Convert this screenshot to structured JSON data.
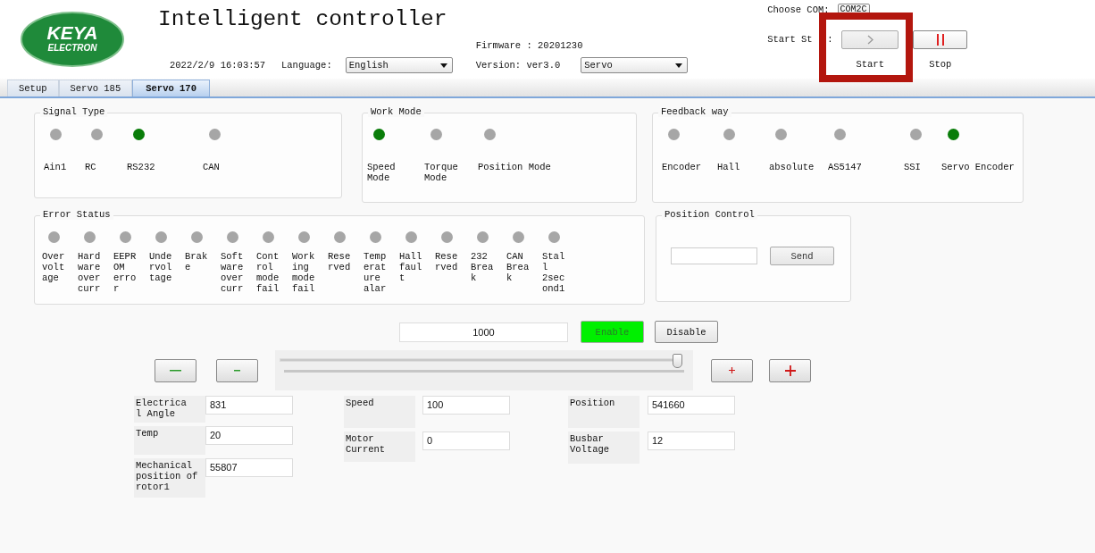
{
  "header": {
    "logo": {
      "line1": "KEYA",
      "line2": "ELECTRON"
    },
    "title": "Intelligent controller",
    "datetime": "2022/2/9 16:03:57",
    "language_label": "Language:",
    "language_value": "English",
    "firmware": "Firmware : 20201230",
    "version": "Version: ver3.0",
    "mode_value": "Servo",
    "com_label": "Choose COM:",
    "com_value": "COM2C",
    "start_stop_label": "Start St",
    "start_stop_colon": ":",
    "buttons": [
      {
        "kind": "start",
        "label": "Start"
      },
      {
        "kind": "stop",
        "label": "Stop"
      }
    ]
  },
  "tabs": [
    {
      "label": "Setup",
      "selected": false
    },
    {
      "label": "Servo 185",
      "selected": false
    },
    {
      "label": "Servo 170",
      "selected": true
    }
  ],
  "signal_type": {
    "title": "Signal Type",
    "items": [
      {
        "label": "Ain1",
        "on": false
      },
      {
        "label": "RC",
        "on": false
      },
      {
        "label": "RS232",
        "on": true
      },
      {
        "label": "CAN",
        "on": false
      }
    ]
  },
  "work_mode": {
    "title": "Work Mode",
    "items": [
      {
        "label": "Speed Mode",
        "on": true
      },
      {
        "label": "Torque Mode",
        "on": false
      },
      {
        "label": "Position Mode",
        "on": false
      }
    ]
  },
  "feedback_way": {
    "title": "Feedback way",
    "items": [
      {
        "label": "Encoder",
        "on": false
      },
      {
        "label": "Hall",
        "on": false
      },
      {
        "label": "absolute",
        "on": false
      },
      {
        "label": "AS5147",
        "on": false
      },
      {
        "label": "SSI",
        "on": false
      },
      {
        "label": "Servo Encoder",
        "on": true
      }
    ]
  },
  "error_status": {
    "title": "Error Status",
    "items": [
      {
        "label": "Overvoltage",
        "on": false
      },
      {
        "label": "Hardware overcurr",
        "on": false
      },
      {
        "label": "EEPROM error",
        "on": false
      },
      {
        "label": "Undervoltage",
        "on": false
      },
      {
        "label": "Brake",
        "on": false
      },
      {
        "label": "Software overcurr",
        "on": false
      },
      {
        "label": "Control mode fail",
        "on": false
      },
      {
        "label": "Working mode fail",
        "on": false
      },
      {
        "label": "Reserved",
        "on": false
      },
      {
        "label": "Temperature alar",
        "on": false
      },
      {
        "label": "Hall fault",
        "on": false
      },
      {
        "label": "Reserved",
        "on": false
      },
      {
        "label": "232 Break",
        "on": false
      },
      {
        "label": "CAN Break",
        "on": false
      },
      {
        "label": "Stall 2second1",
        "on": false
      }
    ]
  },
  "position_control": {
    "title": "Position Control",
    "send_label": "Send"
  },
  "speed_input": {
    "value": "1000"
  },
  "enable_button": {
    "label": "Enable",
    "active": true
  },
  "disable_button": {
    "label": "Disable"
  },
  "step_buttons": [
    {
      "kind": "decrease_large"
    },
    {
      "kind": "decrease_small"
    },
    {
      "kind": "increase_small"
    },
    {
      "kind": "increase_large"
    }
  ],
  "slider": {
    "level": 0.99
  },
  "readout_columns": [
    {
      "items": [
        {
          "label": "Electrical Angle",
          "value": "831"
        },
        {
          "label": "Temp",
          "value": "20"
        },
        {
          "label": "Mechanical position of rotor1",
          "value": "55807"
        }
      ]
    },
    {
      "items": [
        {
          "label": "Speed",
          "value": "100"
        },
        {
          "label": "Motor Current",
          "value": "0"
        }
      ]
    },
    {
      "items": [
        {
          "label": "Position",
          "value": "541660"
        },
        {
          "label": "Busbar Voltage",
          "value": "12"
        }
      ]
    }
  ]
}
